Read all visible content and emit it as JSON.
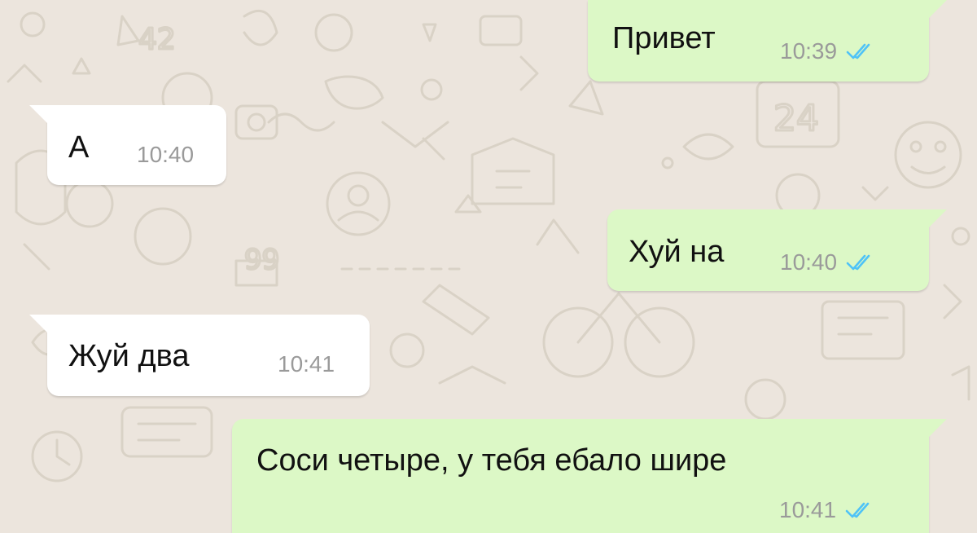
{
  "colors": {
    "chat_background": "#ece5dd",
    "incoming_bubble": "#ffffff",
    "outgoing_bubble": "#dcf8c6",
    "read_checks": "#4fc3f7",
    "timestamp": "#9a9a9a"
  },
  "messages": [
    {
      "direction": "outgoing",
      "text": "Привет",
      "time": "10:39",
      "status_icon": "double-check-read-icon"
    },
    {
      "direction": "incoming",
      "text": "А",
      "time": "10:40"
    },
    {
      "direction": "outgoing",
      "text": "Хуй на",
      "time": "10:40",
      "status_icon": "double-check-read-icon"
    },
    {
      "direction": "incoming",
      "text": "Жуй два",
      "time": "10:41"
    },
    {
      "direction": "outgoing",
      "text": "Соси четыре, у тебя ебало шире",
      "time": "10:41",
      "status_icon": "double-check-read-icon"
    }
  ]
}
